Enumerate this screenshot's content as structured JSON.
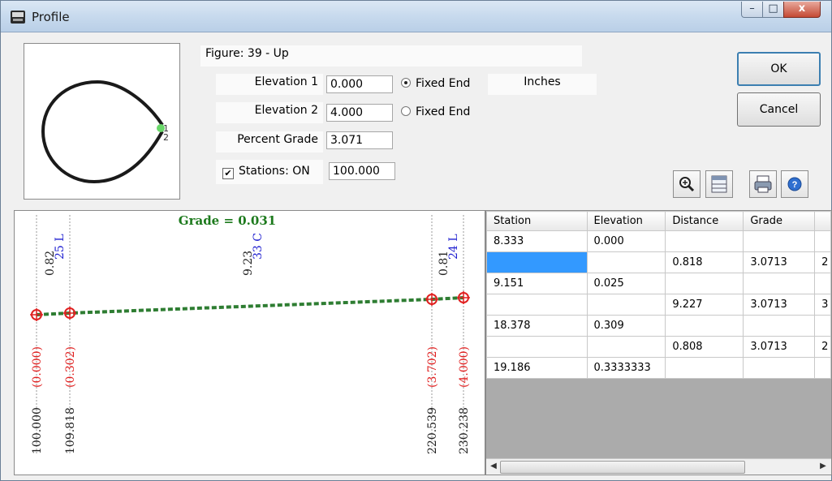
{
  "window": {
    "title": "Profile",
    "min_label": "–",
    "max_label": "□",
    "close_label": "x"
  },
  "figure": {
    "label": "Figure: 39 - Up",
    "point1": "1",
    "point2": "2"
  },
  "form": {
    "elevation1_label": "Elevation 1",
    "elevation1_value": "0.000",
    "fixed_end1": "Fixed End",
    "elevation2_label": "Elevation 2",
    "elevation2_value": "4.000",
    "fixed_end2": "Fixed End",
    "units": "Inches",
    "percent_grade_label": "Percent Grade",
    "percent_grade_value": "3.071",
    "stations_label": "Stations: ON",
    "stations_value": "100.000",
    "fixed_end1_checked": true,
    "fixed_end2_checked": false,
    "stations_checked": true
  },
  "buttons": {
    "ok": "OK",
    "cancel": "Cancel"
  },
  "toolbar": [
    "zoom-in-icon",
    "split-view-icon",
    "print-icon",
    "help-icon"
  ],
  "profile": {
    "grade_label": "Grade = 0.031",
    "top_labels": [
      {
        "len": "0.82",
        "track": "25 L"
      },
      {
        "len": "9.23",
        "track": "33 C"
      },
      {
        "len": "0.81",
        "track": "24 L"
      }
    ],
    "stations": [
      "100.000",
      "109.818",
      "220.539",
      "230.238"
    ],
    "elevations": [
      "(0.000)",
      "(0.302)",
      "(3.702)",
      "(4.000)"
    ],
    "colors": {
      "grade": "#1d7a1d",
      "track": "#1f1fd0",
      "elev": "#e02020",
      "line": "#2e7d32"
    }
  },
  "table": {
    "headers": [
      "Station",
      "Elevation",
      "Distance",
      "Grade",
      ""
    ],
    "rows": [
      [
        "8.333",
        "0.000",
        "",
        "",
        ""
      ],
      [
        "",
        "",
        "0.818",
        "3.0713",
        "2"
      ],
      [
        "9.151",
        "0.025",
        "",
        "",
        ""
      ],
      [
        "",
        "",
        "9.227",
        "3.0713",
        "3"
      ],
      [
        "18.378",
        "0.309",
        "",
        "",
        ""
      ],
      [
        "",
        "",
        "0.808",
        "3.0713",
        "2"
      ],
      [
        "19.186",
        "0.3333333",
        "",
        "",
        ""
      ]
    ]
  }
}
